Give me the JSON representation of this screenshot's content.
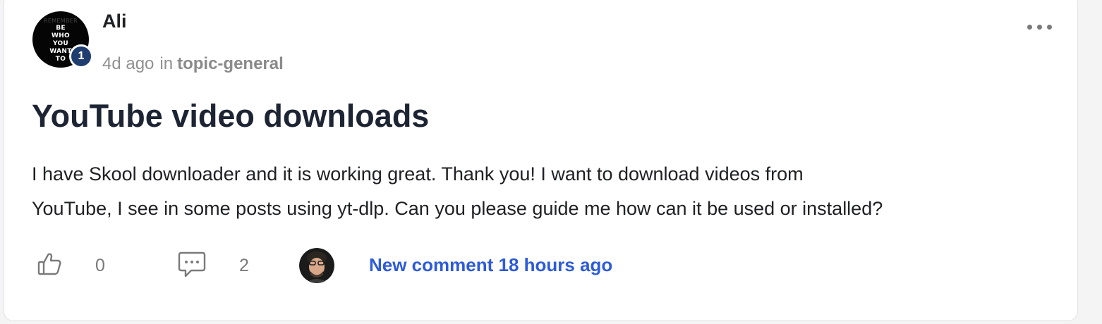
{
  "post": {
    "author": {
      "name": "Ali",
      "level": "1",
      "avatar_lines": [
        "REMEMBER",
        "BE",
        "WHO",
        "YOU",
        "WANT",
        "TO"
      ],
      "avatar_icon": "avatar-image"
    },
    "time": "4d ago",
    "in_label": "in",
    "category": "topic-general",
    "menu_icon": "more-icon",
    "title": "YouTube video downloads",
    "body_lines": [
      "I have Skool downloader and it is working great. Thank you! I want to download videos from",
      "YouTube, I see in some posts using yt-dlp. Can you please guide me how can it be used or installed?"
    ]
  },
  "footer": {
    "like_icon": "thumbs-up-icon",
    "likes": "0",
    "comment_icon": "comment-icon",
    "comments": "2",
    "commenter_avatar_icon": "commenter-avatar",
    "last_comment_text": "New comment 18 hours ago"
  },
  "colors": {
    "level_badge": "#1f3d6e",
    "link": "#2d5bd8",
    "title": "#1d2433",
    "muted": "#909090"
  }
}
